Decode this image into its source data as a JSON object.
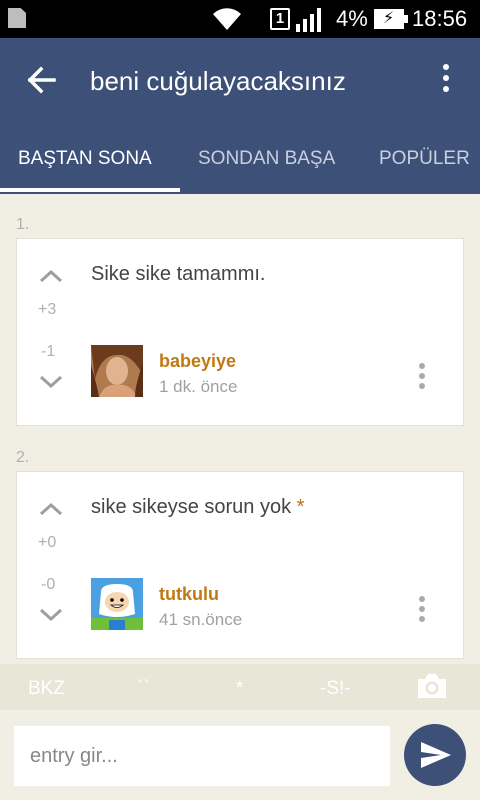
{
  "status_bar": {
    "sim_slot": "1",
    "battery_percent": "4%",
    "time": "18:56"
  },
  "app_bar": {
    "title": "beni cuğulayacaksınız"
  },
  "tabs": [
    {
      "label": "BAŞTAN SONA",
      "active": true
    },
    {
      "label": "SONDAN BAŞA",
      "active": false
    },
    {
      "label": "POPÜLER",
      "active": false
    }
  ],
  "entries": [
    {
      "number": "1.",
      "text": "Sike sike tamammı.",
      "upvotes": "+3",
      "downvotes": "-1",
      "author": "babeyiye",
      "time_ago": "1 dk. önce",
      "starred": false
    },
    {
      "number": "2.",
      "text": "sike sikeyse sorun yok",
      "star": "*",
      "upvotes": "+0",
      "downvotes": "-0",
      "author": "tutkulu",
      "time_ago": "41 sn.önce",
      "starred": true
    }
  ],
  "shortcuts": {
    "bkz": "BKZ",
    "backticks": "``",
    "star": "*",
    "spoiler": "-S!-"
  },
  "input": {
    "placeholder": "entry gir..."
  },
  "colors": {
    "primary": "#3d5078",
    "author": "#c07a14",
    "background": "#f1efe4"
  }
}
